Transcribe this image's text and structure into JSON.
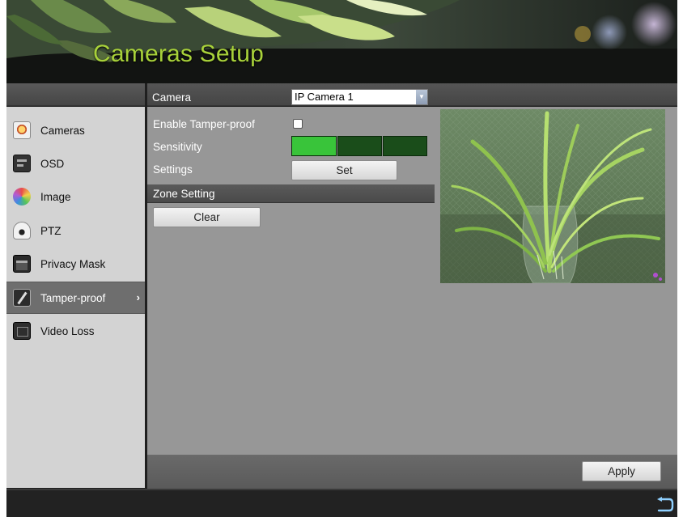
{
  "header": {
    "title": "Cameras Setup"
  },
  "sidebar": {
    "items": [
      {
        "label": "Cameras",
        "icon": "camera-icon"
      },
      {
        "label": "OSD",
        "icon": "osd-icon"
      },
      {
        "label": "Image",
        "icon": "image-color-icon"
      },
      {
        "label": "PTZ",
        "icon": "ptz-dome-icon"
      },
      {
        "label": "Privacy Mask",
        "icon": "privacy-mask-icon"
      },
      {
        "label": "Tamper-proof",
        "icon": "tamper-proof-icon",
        "active": true
      },
      {
        "label": "Video Loss",
        "icon": "video-loss-icon"
      }
    ],
    "active_chevron": "›"
  },
  "main": {
    "camera_label": "Camera",
    "camera_value": "IP Camera 1",
    "enable_label": "Enable Tamper-proof",
    "enable_checked": false,
    "sensitivity_label": "Sensitivity",
    "sensitivity_level": 1,
    "sensitivity_max": 3,
    "settings_label": "Settings",
    "set_button": "Set",
    "zone_setting_label": "Zone Setting",
    "clear_button": "Clear",
    "apply_button": "Apply"
  },
  "colors": {
    "title_green": "#a8d13a",
    "sensitivity_on": "#39c43a",
    "sensitivity_off": "#1a4d1a"
  },
  "footer": {
    "back_icon": "back-arrow-icon"
  }
}
